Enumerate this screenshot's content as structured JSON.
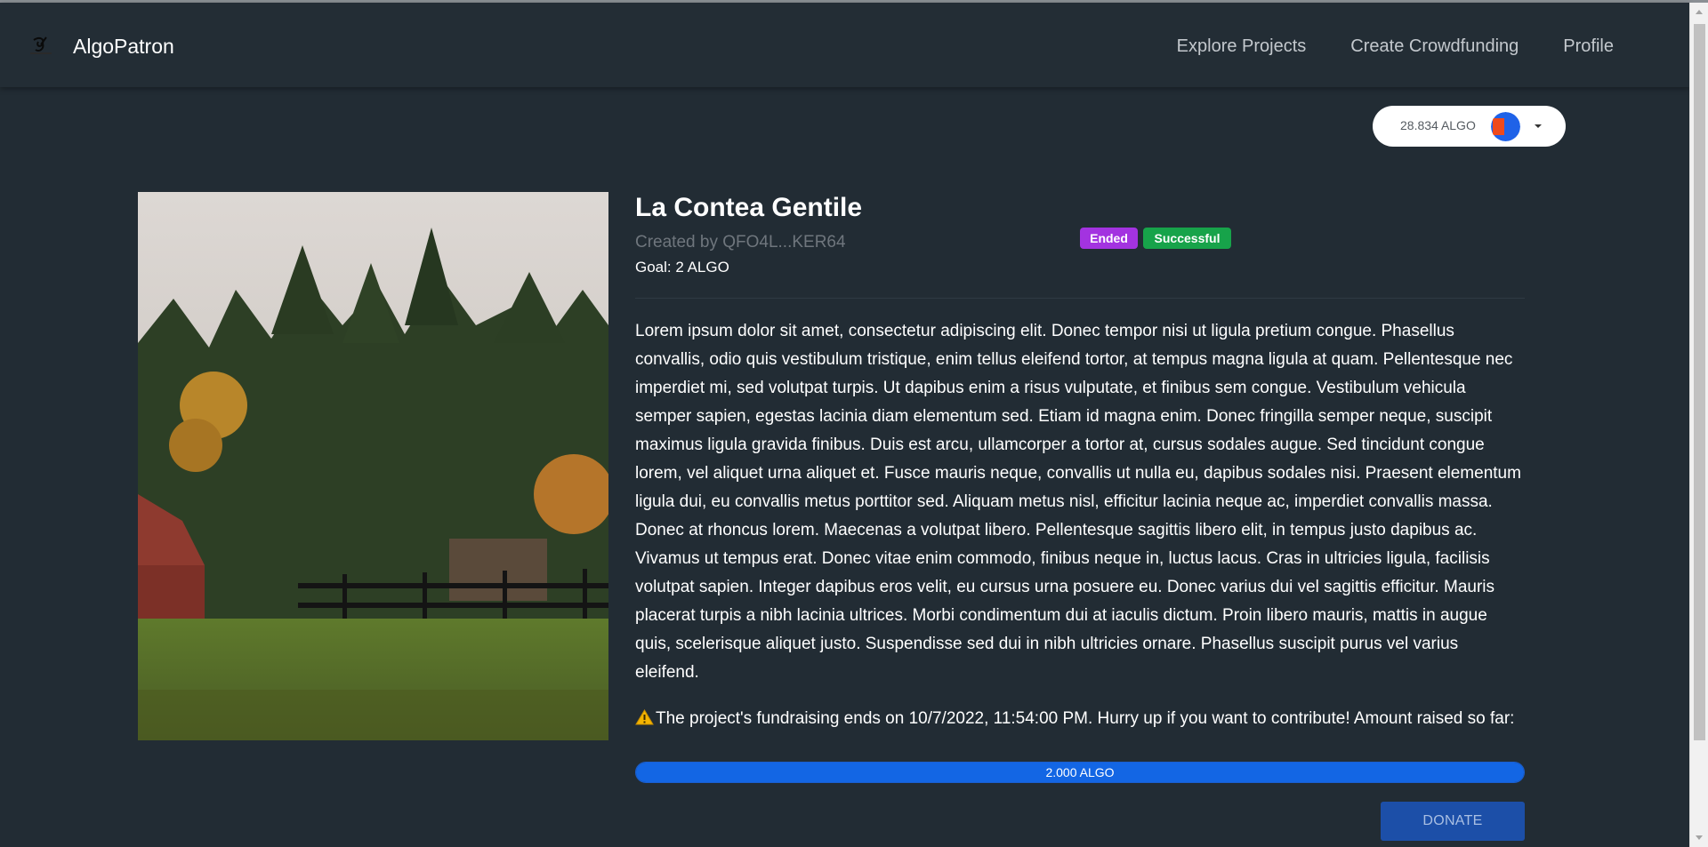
{
  "app": {
    "name": "AlgoPatron"
  },
  "nav": {
    "items": [
      {
        "label": "Explore Projects"
      },
      {
        "label": "Create Crowdfunding"
      },
      {
        "label": "Profile"
      }
    ]
  },
  "wallet": {
    "balance": "28.834 ALGO",
    "avatar_colors": [
      "#ef4a1c",
      "#1f62e8"
    ]
  },
  "project": {
    "title": "La Contea Gentile",
    "creator": "Created by QFO4L...KER64",
    "goal": "Goal: 2 ALGO",
    "badges": [
      {
        "label": "Ended",
        "color": "#a333e0"
      },
      {
        "label": "Successful",
        "color": "#17a34a"
      }
    ],
    "description": "Lorem ipsum dolor sit amet, consectetur adipiscing elit. Donec tempor nisi ut ligula pretium congue. Phasellus convallis, odio quis vestibulum tristique, enim tellus eleifend tortor, at tempus magna ligula at quam. Pellentesque nec imperdiet mi, sed volutpat turpis. Ut dapibus enim a risus vulputate, et finibus sem congue. Vestibulum vehicula semper sapien, egestas lacinia diam elementum sed. Etiam id magna enim. Donec fringilla semper neque, suscipit maximus ligula gravida finibus. Duis est arcu, ullamcorper a tortor at, cursus sodales augue. Sed tincidunt congue lorem, vel aliquet urna aliquet et. Fusce mauris neque, convallis ut nulla eu, dapibus sodales nisi. Praesent elementum ligula dui, eu convallis metus porttitor sed. Aliquam metus nisl, efficitur lacinia neque ac, imperdiet convallis massa. Donec at rhoncus lorem. Maecenas a volutpat libero. Pellentesque sagittis libero elit, in tempus justo dapibus ac. Vivamus ut tempus erat. Donec vitae enim commodo, finibus neque in, luctus lacus. Cras in ultricies ligula, facilisis volutpat sapien. Integer dapibus eros velit, eu cursus urna posuere eu. Donec varius dui vel sagittis efficitur. Mauris placerat turpis a nibh lacinia ultrices. Morbi condimentum dui at iaculis dictum. Proin libero mauris, mattis in augue quis, scelerisque aliquet justo. Suspendisse sed dui in nibh ultricies ornare. Phasellus suscipit purus vel varius eleifend.",
    "notice": "The project's fundraising ends on 10/7/2022, 11:54:00 PM. Hurry up if you want to contribute! Amount raised so far:",
    "raised_label": "2.000 ALGO",
    "progress_percent": 100,
    "donate_label": "DONATE"
  },
  "icons": {
    "logo": "algopatron-logo-icon",
    "warning": "warning-icon",
    "caret": "caret-down-icon"
  }
}
